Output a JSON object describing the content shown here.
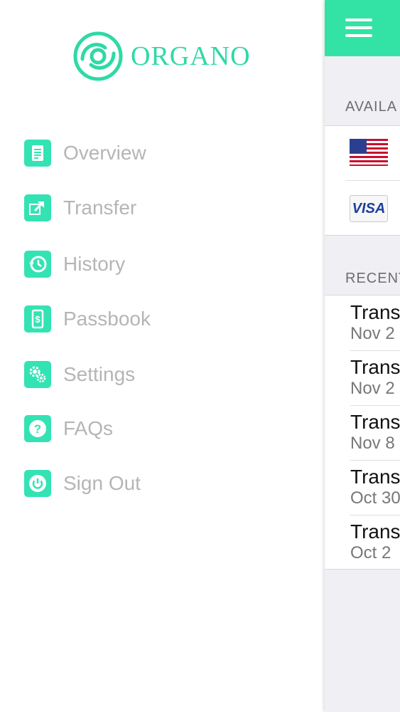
{
  "brand": {
    "name": "ORGANO",
    "color": "#2fd9a6"
  },
  "menu": {
    "accent": "#33e3b3",
    "items": [
      {
        "label": "Overview",
        "icon": "document-icon"
      },
      {
        "label": "Transfer",
        "icon": "transfer-icon"
      },
      {
        "label": "History",
        "icon": "history-icon"
      },
      {
        "label": "Passbook",
        "icon": "phone-dollar-icon"
      },
      {
        "label": "Settings",
        "icon": "gear-icon"
      },
      {
        "label": "FAQs",
        "icon": "question-icon"
      },
      {
        "label": "Sign Out",
        "icon": "power-icon"
      }
    ]
  },
  "main": {
    "header_color": "#33e3a6",
    "available_header": "AVAILA",
    "recent_header": "RECENT",
    "card_visa_label": "VISA",
    "transactions": [
      {
        "title": "Trans",
        "date": "Nov 2"
      },
      {
        "title": "Trans",
        "date": "Nov 2"
      },
      {
        "title": "Trans",
        "date": "Nov 8"
      },
      {
        "title": "Trans",
        "date": "Oct 30"
      },
      {
        "title": "Trans",
        "date": "Oct 2"
      }
    ]
  }
}
